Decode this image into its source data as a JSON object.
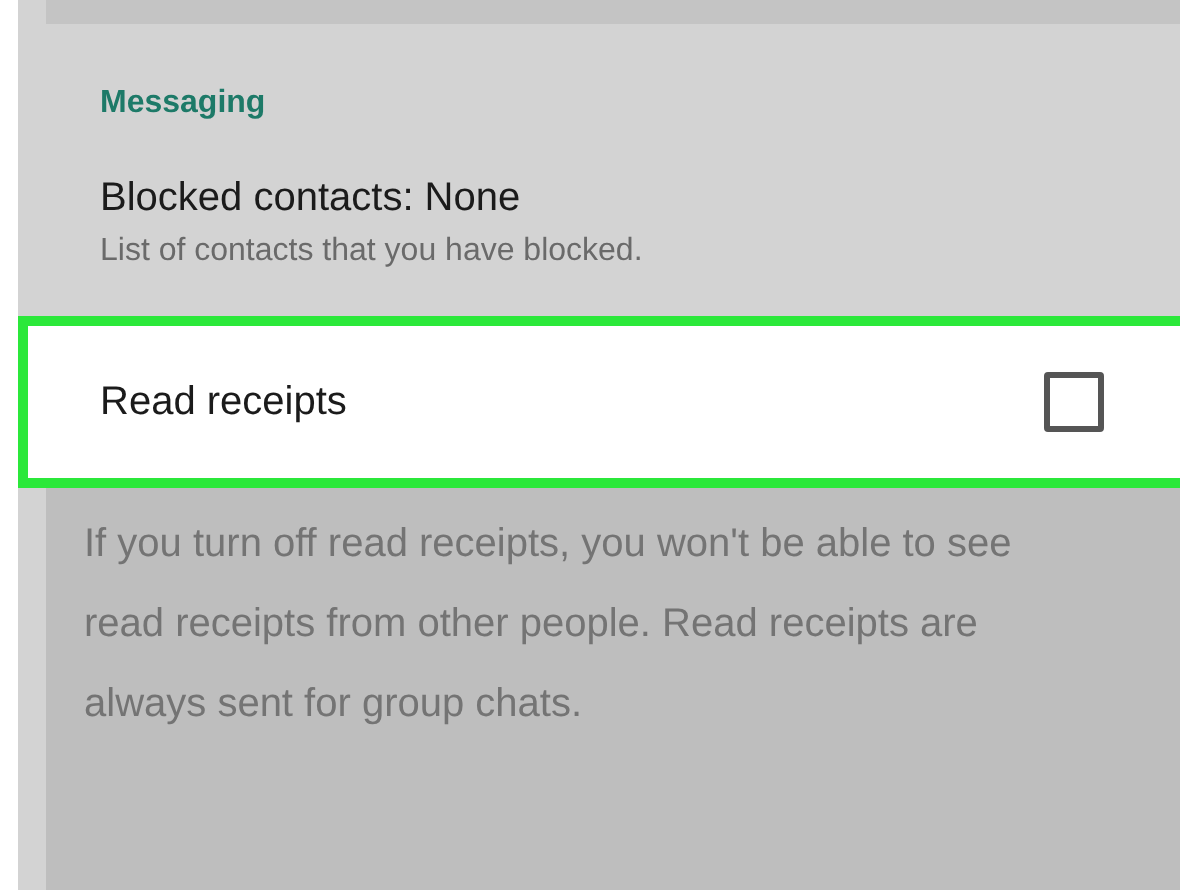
{
  "section": {
    "title": "Messaging"
  },
  "blocked": {
    "title": "Blocked contacts: None",
    "subtitle": "List of contacts that you have blocked."
  },
  "read_receipts": {
    "label": "Read receipts",
    "checked": false
  },
  "dialog": {
    "text": "If you turn off read receipts, you won't be able to see read receipts from other people. Read receipts are always sent for group chats."
  }
}
